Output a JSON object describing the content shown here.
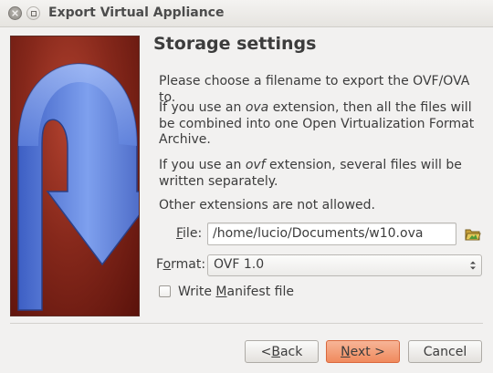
{
  "window": {
    "title": "Export Virtual Appliance"
  },
  "page": {
    "heading": "Storage settings",
    "para1": "Please choose a filename to export the OVF/OVA to.",
    "para2_pre": "If you use an ",
    "para2_em": "ova",
    "para2_post": " extension, then all the files will be combined into one Open Virtualization Format Archive.",
    "para3_pre": "If you use an ",
    "para3_em": "ovf",
    "para3_post": " extension, several files will be written separately.",
    "para4": "Other extensions are not allowed."
  },
  "form": {
    "file_label_mnemonic": "F",
    "file_label_rest": "ile:",
    "file_value": "/home/lucio/Documents/w10.ova",
    "format_label_pre": "F",
    "format_label_mnemonic": "o",
    "format_label_rest": "rmat:",
    "format_value": "OVF 1.0",
    "manifest_pre": "Write ",
    "manifest_mnemonic": "M",
    "manifest_rest": "anifest file",
    "manifest_checked": false
  },
  "buttons": {
    "back_lt": "< ",
    "back_mnemonic": "B",
    "back_rest": "ack",
    "next_mnemonic": "N",
    "next_rest": "ext >",
    "cancel": "Cancel"
  },
  "colors": {
    "accent_button": "#f08a5d",
    "side_image_bg": "#86281b",
    "arrow": "#5a7fd6"
  },
  "icons": {
    "close": "close-icon",
    "maximize": "maximize-icon",
    "folder": "folder-open-icon",
    "combo": "up-down-arrows-icon",
    "side": "export-arrow-icon"
  }
}
